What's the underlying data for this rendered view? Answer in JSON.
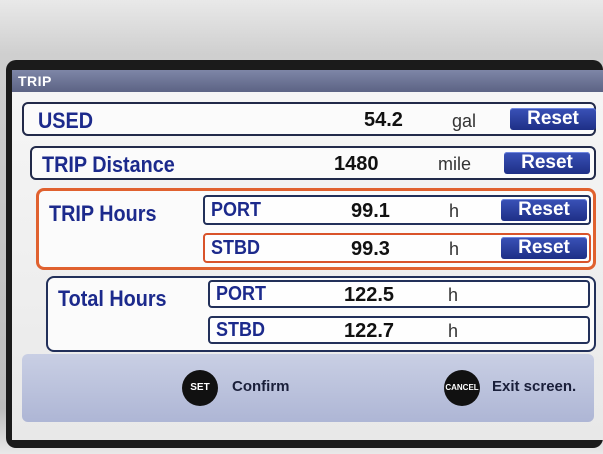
{
  "window": {
    "title": "TRIP"
  },
  "rows": {
    "used": {
      "label": "USED",
      "value": "54.2",
      "unit": "gal",
      "button": "Reset"
    },
    "distance": {
      "label": "TRIP Distance",
      "value": "1480",
      "unit": "mile",
      "button": "Reset"
    }
  },
  "trip_hours": {
    "label": "TRIP Hours",
    "port": {
      "label": "PORT",
      "value": "99.1",
      "unit": "h",
      "button": "Reset"
    },
    "stbd": {
      "label": "STBD",
      "value": "99.3",
      "unit": "h",
      "button": "Reset"
    }
  },
  "total_hours": {
    "label": "Total Hours",
    "port": {
      "label": "PORT",
      "value": "122.5",
      "unit": "h"
    },
    "stbd": {
      "label": "STBD",
      "value": "122.7",
      "unit": "h"
    }
  },
  "footer": {
    "set_button": "SET",
    "confirm_label": "Confirm",
    "cancel_button": "CANCEL",
    "exit_label": "Exit screen."
  }
}
